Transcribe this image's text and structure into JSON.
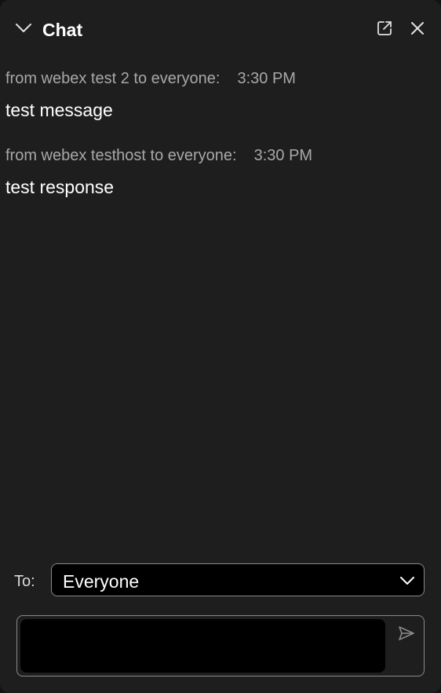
{
  "header": {
    "title": "Chat",
    "collapse_icon": "chevron-down-icon",
    "popout_icon": "pop-out-icon",
    "close_icon": "close-icon"
  },
  "messages": [
    {
      "meta": "from webex test 2 to everyone:",
      "time": "3:30 PM",
      "text": "test message"
    },
    {
      "meta": "from webex testhost to everyone:",
      "time": "3:30 PM",
      "text": "test response"
    }
  ],
  "recipient": {
    "label": "To:",
    "selected": "Everyone"
  },
  "composer": {
    "value": "",
    "send_icon": "send-icon"
  },
  "colors": {
    "panel_bg": "#1e1e1e",
    "input_bg": "#000000",
    "meta_text": "#a8a8a8",
    "message_text": "#ffffff",
    "border": "#8a8a8a"
  }
}
